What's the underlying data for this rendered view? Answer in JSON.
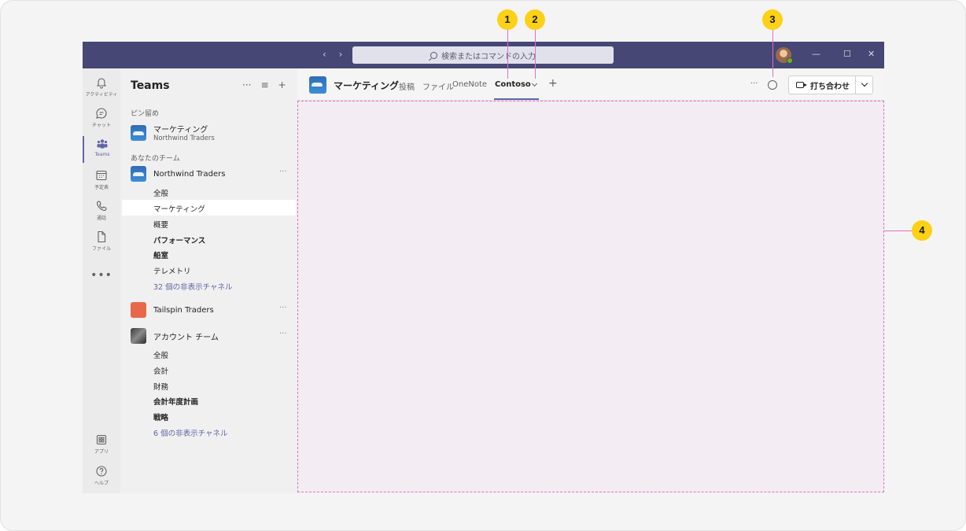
{
  "titlebar": {
    "search_placeholder": "検索またはコマンドの入力",
    "nav_arrows": "‹ ›",
    "min": "—",
    "max": "☐",
    "close": "✕"
  },
  "rail": {
    "activity": "アクティビティ",
    "chat": "チャット",
    "teams": "Teams",
    "calendar": "予定表",
    "calls": "通話",
    "files": "ファイル",
    "more": "•••",
    "apps": "アプリ",
    "help": "ヘルプ"
  },
  "teams_panel": {
    "title": "Teams",
    "more": "···",
    "filter": "≡",
    "add": "+",
    "pinned_label": "ピン留め",
    "pinned": {
      "name": "マーケティング",
      "sub": "Northwind Traders"
    },
    "your_teams_label": "あなたのチーム",
    "team1": {
      "name": "Northwind Traders",
      "dots": "···",
      "channels": [
        "全般",
        "マーケティング",
        "概要",
        "パフォーマンス",
        "船室",
        "テレメトリ"
      ],
      "hidden": "32 個の非表示チャネル"
    },
    "team2": {
      "name": "Tailspin Traders",
      "dots": "···"
    },
    "team3": {
      "name": "アカウント チーム",
      "dots": "···",
      "channels": [
        "全般",
        "会計",
        "財務",
        "会計年度計画",
        "戦略"
      ],
      "hidden": "6 個の非表示チャネル"
    }
  },
  "header": {
    "title": "マーケティング",
    "tabs": [
      "投稿",
      "ファイル",
      "OneNote",
      "Contoso"
    ],
    "add_tab": "+",
    "more": "···",
    "meet_label": "打ち合わせ"
  },
  "callouts": [
    "1",
    "2",
    "3",
    "4"
  ]
}
